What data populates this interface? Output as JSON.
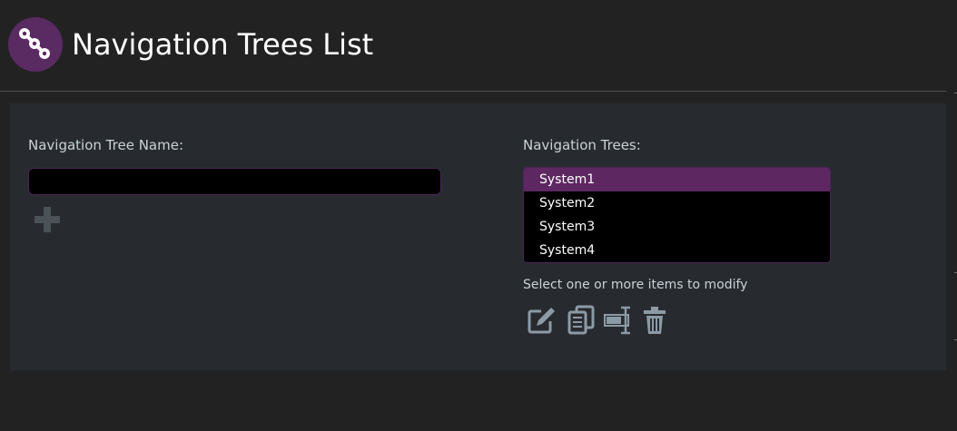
{
  "header": {
    "title": "Navigation Trees List",
    "logo_icon": "connected-nodes-icon",
    "logo_color": "#5a2a63"
  },
  "form": {
    "name_label": "Navigation Tree Name:",
    "name_value": "",
    "add_icon": "plus-icon"
  },
  "trees": {
    "label": "Navigation Trees:",
    "items": [
      "System1",
      "System2",
      "System3",
      "System4"
    ],
    "selected": "System1",
    "selected_color": "#5d2762",
    "hint": "Select one or more items to modify"
  },
  "toolbar": {
    "icons": [
      "edit-icon",
      "copy-icon",
      "rename-icon",
      "trash-icon"
    ]
  }
}
